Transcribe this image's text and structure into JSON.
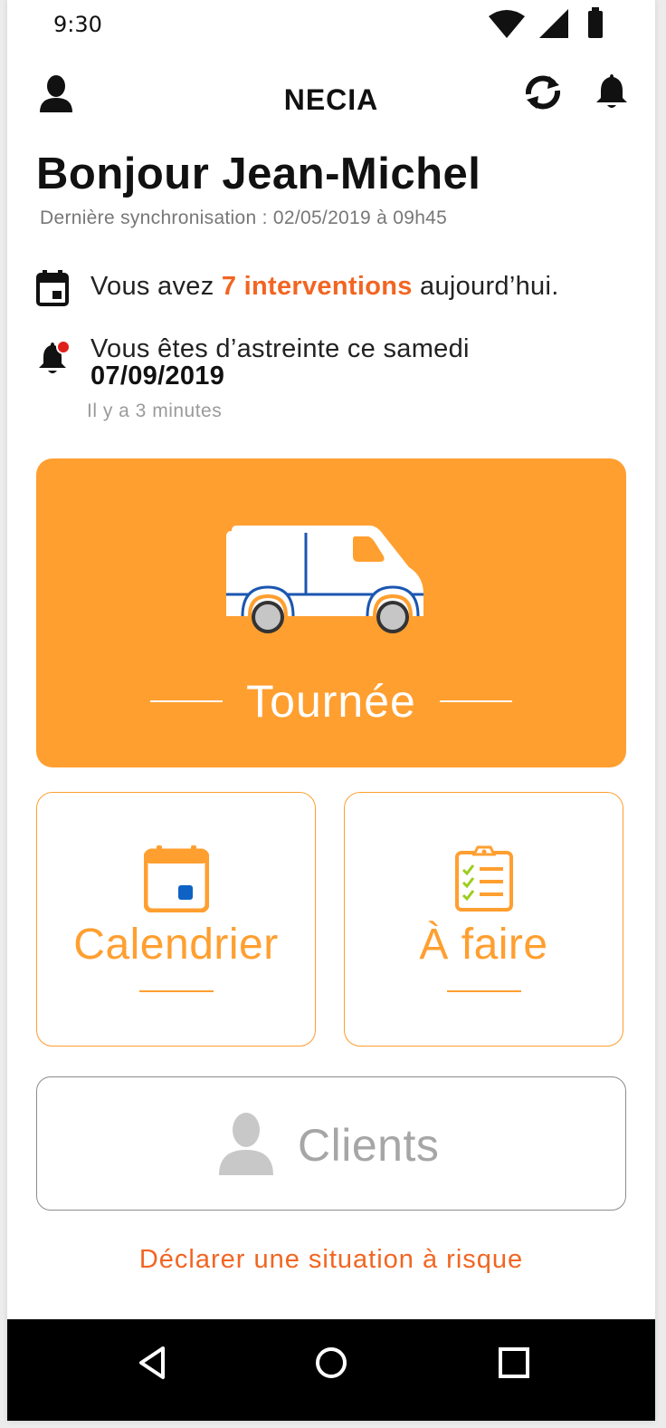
{
  "status_bar": {
    "time": "9:30"
  },
  "app_bar": {
    "title": "NECIA"
  },
  "greeting": {
    "title": "Bonjour Jean-Michel",
    "last_sync": "Dernière synchronisation : 02/05/2019 à 09h45"
  },
  "interventions": {
    "prefix": "Vous avez ",
    "highlight": "7 interventions",
    "suffix": " aujourd’hui."
  },
  "on_call": {
    "text": "Vous êtes d’astreinte ce samedi",
    "date": "07/09/2019",
    "time_ago": "Il y a 3 minutes"
  },
  "tiles": {
    "tour": {
      "label": "Tournée"
    },
    "calendar": {
      "label": "Calendrier"
    },
    "todo": {
      "label": "À faire"
    },
    "clients": {
      "label": "Clients"
    }
  },
  "risk_link": "Déclarer une situation à risque",
  "colors": {
    "primary_orange": "#ff9f30",
    "accent_orange": "#f26522",
    "van_blue": "#1b56b0",
    "todo_check_green": "#9ccd1e"
  },
  "icons": {
    "status": [
      "wifi-icon",
      "cell-signal-icon",
      "battery-icon"
    ],
    "app_bar": [
      "profile-icon",
      "sync-icon",
      "notification-bell-icon"
    ],
    "nav": [
      "back-icon",
      "home-icon",
      "recents-icon"
    ]
  }
}
